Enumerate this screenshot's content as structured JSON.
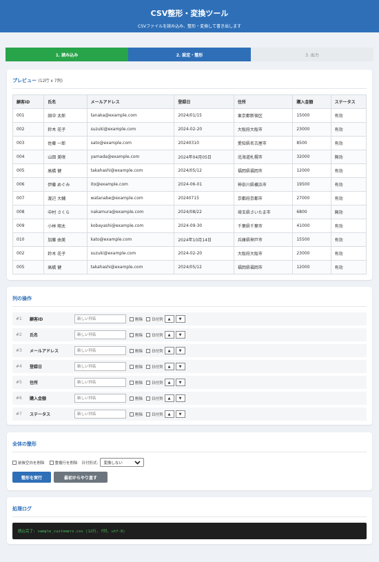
{
  "header": {
    "title": "CSV整形・変換ツール",
    "subtitle": "CSVファイルを読み込み、整形・変換して書き出します"
  },
  "steps": [
    {
      "label": "1. 読み込み",
      "state": "done"
    },
    {
      "label": "2. 設定・整形",
      "state": "active"
    },
    {
      "label": "3. 出力",
      "state": "todo"
    }
  ],
  "preview": {
    "title": "プレビュー",
    "count": "(12行 x 7列)",
    "headers": [
      "顧客ID",
      "氏名",
      "メールアドレス",
      "登録日",
      "住所",
      "購入金額",
      "ステータス"
    ],
    "rows": [
      [
        "001",
        "田中 太郎",
        "tanaka@example.com",
        "2024/01/15",
        "東京都新宿区",
        "15000",
        "有効"
      ],
      [
        "002",
        "鈴木 花子",
        "suzuki@example.com",
        "2024-02-20",
        "大阪府大阪市",
        "23000",
        "有効"
      ],
      [
        "003",
        "佐藤 一郎",
        "sato@example.com",
        "20240310",
        "愛知県名古屋市",
        "8500",
        "有効"
      ],
      [
        "004",
        "山田 美咲",
        "yamada@example.com",
        "2024年04月05日",
        "北海道札幌市",
        "32000",
        "無効"
      ],
      [
        "005",
        "高橋 健",
        "takahashi@example.com",
        "2024/05/12",
        "福岡県福岡市",
        "12000",
        "有効"
      ],
      [
        "006",
        "伊藤 めぐみ",
        "ito@example.com",
        "2024-06-01",
        "神奈川県横浜市",
        "19500",
        "有効"
      ],
      [
        "007",
        "渡辺 大輔",
        "watanabe@example.com",
        "20240715",
        "京都府京都市",
        "27000",
        "有効"
      ],
      [
        "008",
        "中村 さくら",
        "nakamura@example.com",
        "2024/08/22",
        "埼玉県さいたま市",
        "6800",
        "無効"
      ],
      [
        "009",
        "小林 翔太",
        "kobayashi@example.com",
        "2024-09-30",
        "千葉県千葉市",
        "41000",
        "有効"
      ],
      [
        "010",
        "加藤 由美",
        "kato@example.com",
        "2024年10月14日",
        "兵庫県神戸市",
        "15500",
        "有効"
      ],
      [
        "002",
        "鈴木 花子",
        "suzuki@example.com",
        "2024-02-20",
        "大阪府大阪市",
        "23000",
        "有効"
      ],
      [
        "005",
        "高橋 健",
        "takahashi@example.com",
        "2024/05/12",
        "福岡県福岡市",
        "12000",
        "有効"
      ]
    ]
  },
  "columns": {
    "title": "列の操作",
    "placeholder": "新しい列名",
    "delete_label": "削除",
    "date_label": "日付列",
    "up": "▲",
    "down": "▼",
    "items": [
      {
        "num": "#1",
        "name": "顧客ID"
      },
      {
        "num": "#2",
        "name": "氏名"
      },
      {
        "num": "#3",
        "name": "メールアドレス"
      },
      {
        "num": "#4",
        "name": "登録日"
      },
      {
        "num": "#5",
        "name": "住所"
      },
      {
        "num": "#6",
        "name": "購入金額"
      },
      {
        "num": "#7",
        "name": "ステータス"
      }
    ]
  },
  "global": {
    "title": "全体の整形",
    "trim_label": "前後空白を削除",
    "dedupe_label": "重複行を削除",
    "date_format_label": "日付形式:",
    "date_format_value": "変換しない",
    "run_button": "整形を実行",
    "reset_button": "最初からやり直す"
  },
  "log": {
    "title": "処理ログ",
    "message": "読込完了: sample_customers.csv (12行, 7列, utf-8)"
  },
  "colors": {
    "primary": "#2e6fb8",
    "success": "#28a44a",
    "gray": "#6c757d",
    "log_bg": "#1f1f1f",
    "log_text": "#4fbf5e"
  }
}
